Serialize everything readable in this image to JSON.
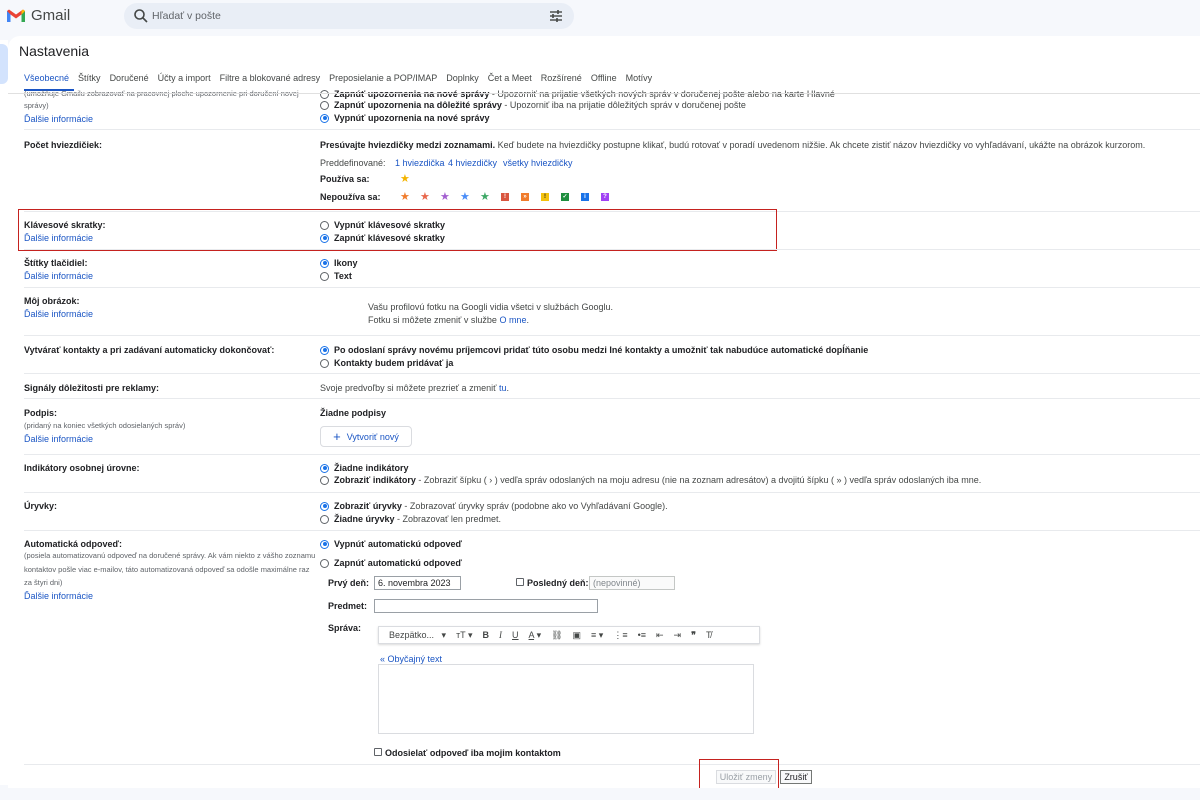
{
  "header": {
    "app_name": "Gmail",
    "search_placeholder": "Hľadať v pošte"
  },
  "page": {
    "title": "Nastavenia",
    "tabs": [
      "Všeobecné",
      "Štítky",
      "Doručené",
      "Účty a import",
      "Filtre a blokované adresy",
      "Preposielanie a POP/IMAP",
      "Doplnky",
      "Čet a Meet",
      "Rozšírené",
      "Offline",
      "Motívy"
    ],
    "active_tab": "Všeobecné"
  },
  "more_info": "Ďalšie informácie",
  "notifications": {
    "sub": "(umožňuje Gmailu zobrazovať na pracovnej ploche upozornenie pri doručení novej správy)",
    "opt1_title": "Zapnúť upozornenia na nové správy",
    "opt1_desc": " - Upozorniť na prijatie všetkých nových správ v doručenej pošte alebo na karte Hlavné",
    "opt2_title": "Zapnúť upozornenia na dôležité správy",
    "opt2_desc": " - Upozorniť iba na prijatie dôležitých správ v doručenej pošte",
    "opt3_title": "Vypnúť upozornenia na nové správy"
  },
  "stars": {
    "label": "Počet hviezdičiek:",
    "intro_bold": "Presúvajte hviezdičky medzi zoznamami.",
    "intro_text": "Keď budete na hviezdičky postupne klikať, budú rotovať v poradí uvedenom nižšie. Ak chcete zistiť názov hviezdičky vo vyhľadávaní, ukážte na obrázok kurzorom.",
    "presets_label": "Preddefinované:",
    "preset1": "1 hviezdička",
    "preset2": "4 hviezdičky",
    "preset3": "všetky hviezdičky",
    "in_use": "Používa sa:",
    "not_in_use": "Nepoužíva sa:",
    "colors": {
      "yellow": "#f4b400",
      "orange": "#f07c2c",
      "red": "#e8674c",
      "purple": "#a35fd0",
      "blue": "#4a8df7",
      "green": "#3ea866"
    }
  },
  "shortcuts": {
    "label": "Klávesové skratky:",
    "off": "Vypnúť klávesové skratky",
    "on": "Zapnúť klávesové skratky"
  },
  "button_labels": {
    "label": "Štítky tlačidiel:",
    "icons": "Ikony",
    "text": "Text"
  },
  "picture": {
    "label": "Môj obrázok:",
    "line1": "Vašu profilovú fotku na Googli vidia všetci v službách Googlu.",
    "line2": "Fotku si môžete zmeniť v službe ",
    "link": "O mne",
    "dot": "."
  },
  "contacts": {
    "label": "Vytvárať kontakty a pri zadávaní automaticky dokončovať:",
    "opt1": "Po odoslaní správy novému príjemcovi pridať túto osobu medzi Iné kontakty a umožniť tak nabudúce automatické dopĺňanie",
    "opt2": "Kontakty budem pridávať ja"
  },
  "ads": {
    "label": "Signály dôležitosti pre reklamy:",
    "text": "Svoje predvoľby si môžete prezrieť a zmeniť ",
    "link": "tu",
    "dot": "."
  },
  "signature": {
    "label": "Podpis:",
    "sub": "(pridaný na koniec všetkých odosielaných správ)",
    "none": "Žiadne podpisy",
    "create": "Vytvoriť nový"
  },
  "indicators": {
    "label": "Indikátory osobnej úrovne:",
    "opt1": "Žiadne indikátory",
    "opt2_title": "Zobraziť indikátory",
    "opt2_desc": " - Zobraziť šípku ( › ) vedľa správ odoslaných na moju adresu (nie na zoznam adresátov) a dvojitú šípku ( » ) vedľa správ odoslaných iba mne."
  },
  "snippets": {
    "label": "Úryvky:",
    "opt1_title": "Zobraziť úryvky",
    "opt1_desc": " - Zobrazovať úryvky správ (podobne ako vo Vyhľadávaní Google).",
    "opt2_title": "Žiadne úryvky",
    "opt2_desc": " - Zobrazovať len predmet."
  },
  "autoreply": {
    "label": "Automatická odpoveď:",
    "sub1": "(posiela automatizovanú odpoveď na doručené správy. Ak vám niekto z vášho zoznamu",
    "sub2": "kontaktov pošle viac e-mailov, táto automatizovaná odpoveď sa odošle maximálne raz",
    "sub3": "za štyri dni)",
    "off": "Vypnúť automatickú odpoveď",
    "on": "Zapnúť automatickú odpoveď",
    "first_day_label": "Prvý deň:",
    "first_day_value": "6. novembra 2023",
    "last_day_label": "Posledný deň:",
    "last_day_placeholder": "(nepovinné)",
    "subject_label": "Predmet:",
    "message_label": "Správa:",
    "font_name": "Bezpätko...",
    "plain_text": "« Obyčajný text",
    "contacts_only": "Odosielať odpoveď iba mojim kontaktom"
  },
  "footer": {
    "save": "Uložiť zmeny",
    "cancel": "Zrušiť"
  }
}
